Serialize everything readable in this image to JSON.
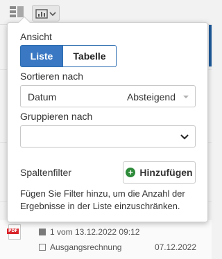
{
  "popup": {
    "view_label": "Ansicht",
    "view_options": [
      "Liste",
      "Tabelle"
    ],
    "sort_label": "Sortieren nach",
    "sort_field": "Datum",
    "sort_direction": "Absteigend",
    "group_label": "Gruppieren nach",
    "group_value": "",
    "column_filter_label": "Spaltenfilter",
    "add_button_label": "Hinzufügen",
    "hint_text": "Fügen Sie Filter hinzu, um die Anzahl der Ergebnisse in der Liste einzuschränken."
  },
  "background_item": {
    "line1": "1 vom 13.12.2022 09:12",
    "line2": "Ausgangsrechnung",
    "date": "07.12.2022",
    "file_type": "PDF"
  },
  "colors": {
    "accent": "#3a78c3",
    "add_icon": "#2e8b3a",
    "pdf_red": "#d9262c"
  },
  "icons": [
    "list-toggle-icon",
    "chart-view-icon",
    "chevron-down-icon",
    "plus-circle-icon",
    "pdf-file-icon"
  ]
}
